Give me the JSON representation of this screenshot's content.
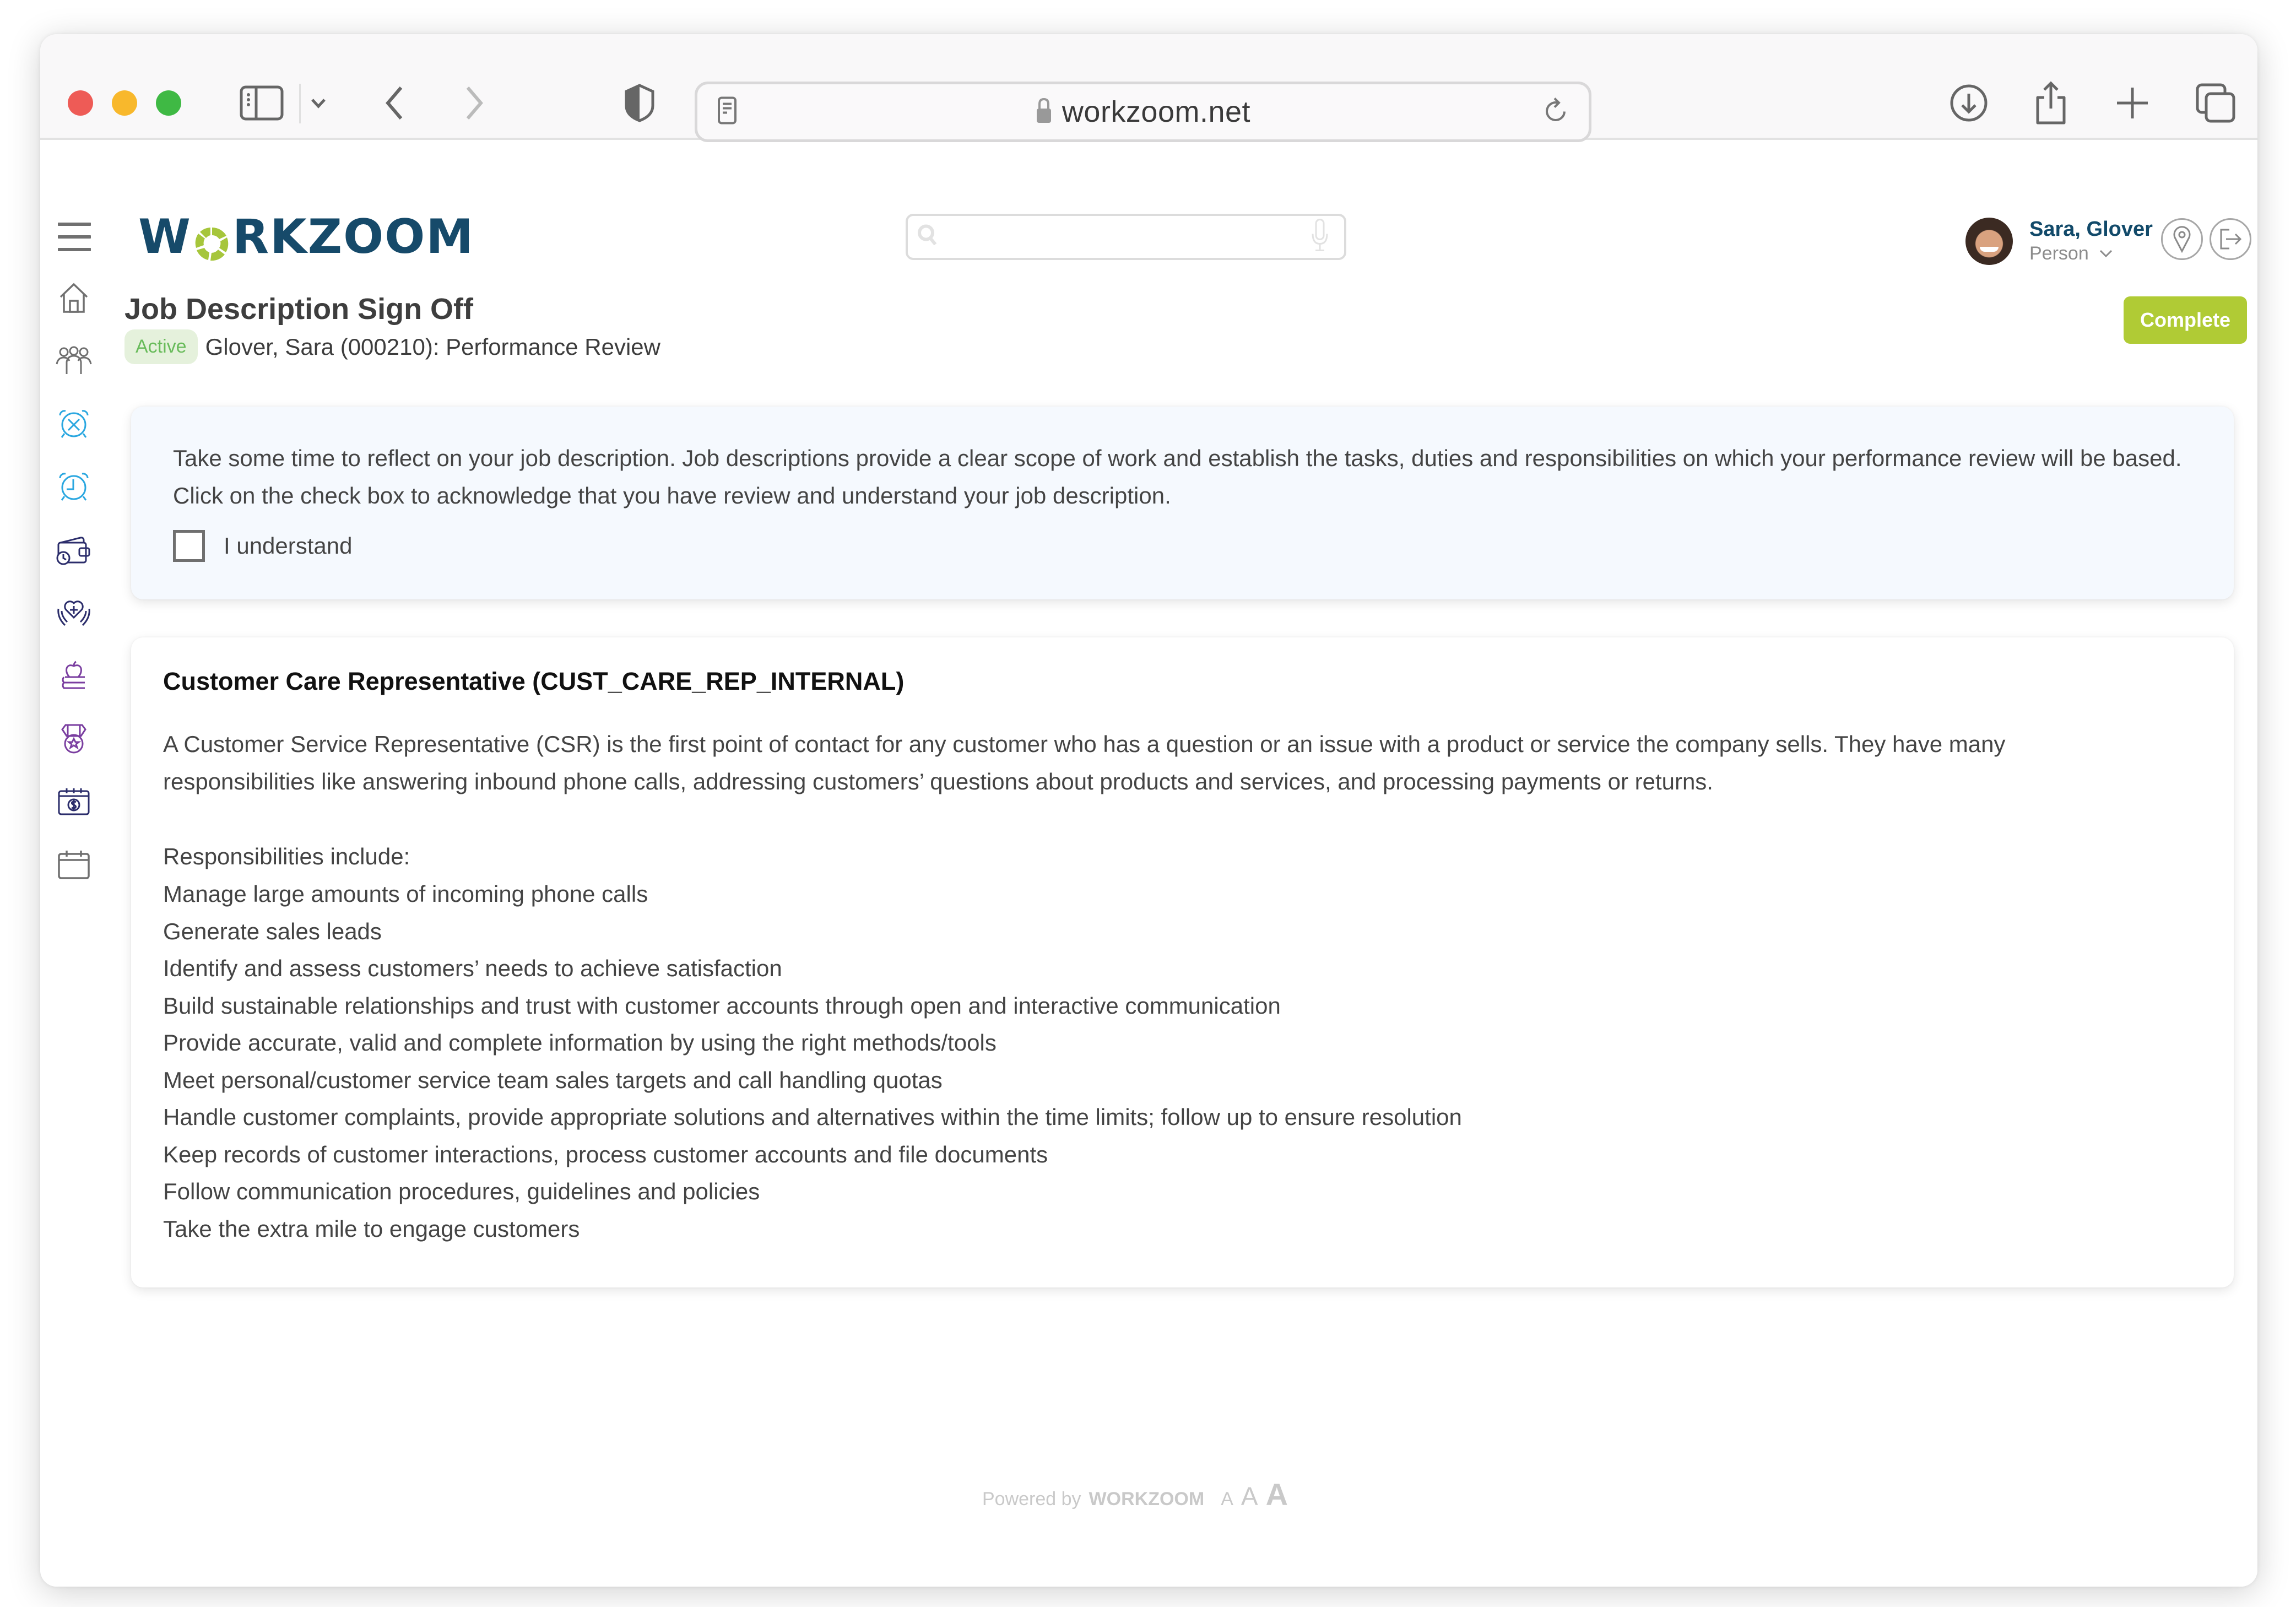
{
  "browser": {
    "url": "workzoom.net",
    "icons": {
      "sidebar_toggle": "sidebar-icon",
      "tab_menu": "chevron-down-icon",
      "back": "chevron-left-icon",
      "forward": "chevron-right-icon",
      "privacy": "shield-icon",
      "reader": "page-icon",
      "lock": "lock-icon",
      "reload": "reload-icon",
      "download": "download-icon",
      "share": "share-icon",
      "new_tab": "plus-icon",
      "tabs": "tabs-icon"
    }
  },
  "app": {
    "brand": {
      "prefix": "W",
      "suffix": "RKZOOM",
      "primary_color": "#164a6a",
      "accent_color": "#a6c63b"
    },
    "search": {
      "value": "",
      "placeholder": ""
    },
    "user": {
      "name": "Sara, Glover",
      "role": "Person"
    },
    "sidebar": {
      "items": [
        {
          "name": "home",
          "icon": "home-icon",
          "color": "#707070"
        },
        {
          "name": "people",
          "icon": "people-icon",
          "color": "#707070"
        },
        {
          "name": "time-off",
          "icon": "alarm-x-icon",
          "color": "#2aa7e0"
        },
        {
          "name": "time-tracking",
          "icon": "alarm-clock-icon",
          "color": "#2aa7e0"
        },
        {
          "name": "payroll",
          "icon": "wallet-clock-icon",
          "color": "#2b2d6b"
        },
        {
          "name": "benefits",
          "icon": "heart-hands-icon",
          "color": "#2b2d6b"
        },
        {
          "name": "learning",
          "icon": "apple-books-icon",
          "color": "#7a3ea0"
        },
        {
          "name": "recognition",
          "icon": "medal-icon",
          "color": "#7a3ea0"
        },
        {
          "name": "pay-calendar",
          "icon": "calendar-dollar-icon",
          "color": "#2b2d6b"
        },
        {
          "name": "calendar",
          "icon": "calendar-icon",
          "color": "#707070"
        }
      ]
    },
    "page": {
      "title": "Job Description Sign Off",
      "status_badge": "Active",
      "subtitle": "Glover, Sara (000210): Performance Review",
      "complete_button": "Complete",
      "complete_color": "#b0cb35"
    },
    "acknowledgement": {
      "text": "Take some time to reflect on your job description. Job descriptions provide a clear scope of work and establish the tasks, duties and responsibilities on which your performance review will be based. Click on the check box to acknowledge that you have review and understand your job description.",
      "checkbox_label": "I understand",
      "checked": false
    },
    "job": {
      "title": "Customer Care Representative (CUST_CARE_REP_INTERNAL)",
      "description": "A Customer Service Representative (CSR) is the first point of contact for any customer who has a question or an issue with a product or service the company sells. They have many responsibilities like answering inbound phone calls, addressing customers’ questions about products and services, and processing payments or returns.",
      "responsibilities_heading": "Responsibilities include:",
      "responsibilities": [
        "Manage large amounts of incoming phone calls",
        "Generate sales leads",
        "Identify and assess customers’ needs to achieve satisfaction",
        "Build sustainable relationships and trust with customer accounts through open and interactive communication",
        "Provide accurate, valid and complete information by using the right methods/tools",
        "Meet personal/customer service team sales targets and call handling quotas",
        "Handle customer complaints, provide appropriate solutions and alternatives within the time limits; follow up to ensure resolution",
        "Keep records of customer interactions, process customer accounts and file documents",
        "Follow communication procedures, guidelines and policies",
        "Take the extra mile to engage customers"
      ]
    },
    "footer": {
      "powered_by": "Powered by",
      "brand": "WORKZOOM",
      "font_sizes": [
        "A",
        "A",
        "A"
      ]
    }
  }
}
